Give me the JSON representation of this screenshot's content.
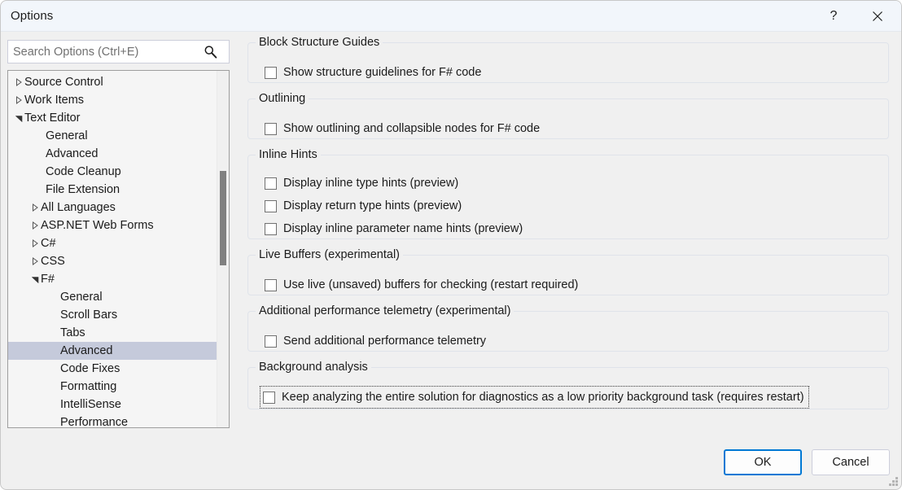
{
  "window": {
    "title": "Options",
    "help_label": "?",
    "close_label": "✕"
  },
  "search": {
    "placeholder": "Search Options (Ctrl+E)",
    "value": "",
    "icon": "search-icon"
  },
  "tree": {
    "items": [
      {
        "label": "Source Control",
        "level": 0,
        "arrow": "collapsed",
        "selected": false
      },
      {
        "label": "Work Items",
        "level": 0,
        "arrow": "collapsed",
        "selected": false
      },
      {
        "label": "Text Editor",
        "level": 0,
        "arrow": "expanded",
        "selected": false
      },
      {
        "label": "General",
        "level": 1,
        "arrow": "none",
        "selected": false
      },
      {
        "label": "Advanced",
        "level": 1,
        "arrow": "none",
        "selected": false
      },
      {
        "label": "Code Cleanup",
        "level": 1,
        "arrow": "none",
        "selected": false
      },
      {
        "label": "File Extension",
        "level": 1,
        "arrow": "none",
        "selected": false
      },
      {
        "label": "All Languages",
        "level": 1,
        "arrow": "collapsed",
        "selected": false
      },
      {
        "label": "ASP.NET Web Forms",
        "level": 1,
        "arrow": "collapsed",
        "selected": false
      },
      {
        "label": "C#",
        "level": 1,
        "arrow": "collapsed",
        "selected": false
      },
      {
        "label": "CSS",
        "level": 1,
        "arrow": "collapsed",
        "selected": false
      },
      {
        "label": "F#",
        "level": 1,
        "arrow": "expanded",
        "selected": false
      },
      {
        "label": "General",
        "level": 2,
        "arrow": "none",
        "selected": false
      },
      {
        "label": "Scroll Bars",
        "level": 2,
        "arrow": "none",
        "selected": false
      },
      {
        "label": "Tabs",
        "level": 2,
        "arrow": "none",
        "selected": false
      },
      {
        "label": "Advanced",
        "level": 2,
        "arrow": "none",
        "selected": true
      },
      {
        "label": "Code Fixes",
        "level": 2,
        "arrow": "none",
        "selected": false
      },
      {
        "label": "Formatting",
        "level": 2,
        "arrow": "none",
        "selected": false
      },
      {
        "label": "IntelliSense",
        "level": 2,
        "arrow": "none",
        "selected": false
      },
      {
        "label": "Performance",
        "level": 2,
        "arrow": "none",
        "selected": false
      }
    ],
    "selection_color": "#c5cadb",
    "scrollbar": {
      "thumb_color": "#808080"
    }
  },
  "groups": [
    {
      "title": "Block Structure Guides",
      "options": [
        {
          "label": "Show structure guidelines for F# code",
          "checked": false,
          "focused": false
        }
      ]
    },
    {
      "title": "Outlining",
      "options": [
        {
          "label": "Show outlining and collapsible nodes for F# code",
          "checked": false,
          "focused": false
        }
      ]
    },
    {
      "title": "Inline Hints",
      "options": [
        {
          "label": "Display inline type hints (preview)",
          "checked": false,
          "focused": false
        },
        {
          "label": "Display return type hints (preview)",
          "checked": false,
          "focused": false
        },
        {
          "label": "Display inline parameter name hints (preview)",
          "checked": false,
          "focused": false
        }
      ]
    },
    {
      "title": "Live Buffers (experimental)",
      "options": [
        {
          "label": "Use live (unsaved) buffers for checking (restart required)",
          "checked": false,
          "focused": false
        }
      ]
    },
    {
      "title": "Additional performance telemetry (experimental)",
      "options": [
        {
          "label": "Send additional performance telemetry",
          "checked": false,
          "focused": false
        }
      ]
    },
    {
      "title": "Background analysis",
      "options": [
        {
          "label": "Keep analyzing the entire solution for diagnostics as a low priority background task (requires restart)",
          "checked": false,
          "focused": true
        }
      ]
    }
  ],
  "footer": {
    "ok_label": "OK",
    "cancel_label": "Cancel",
    "default_button_accent": "#0078d4"
  }
}
